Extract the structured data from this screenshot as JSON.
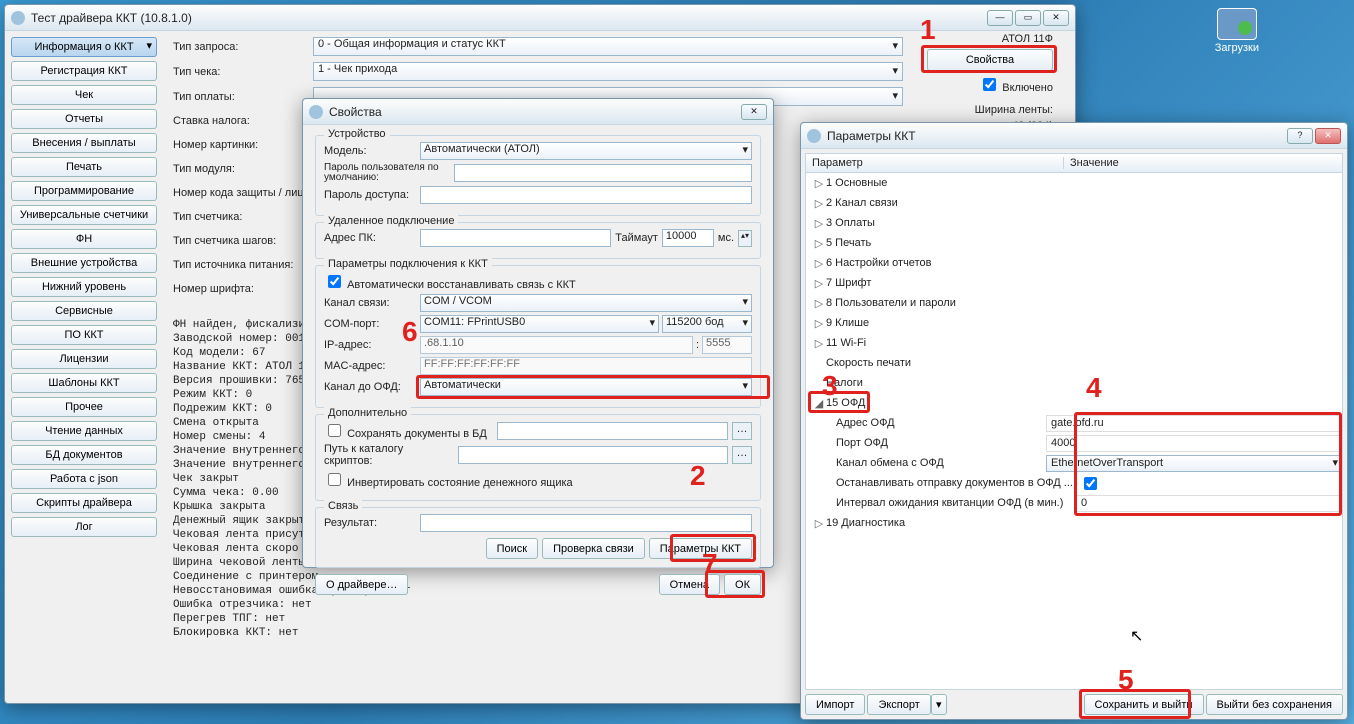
{
  "desktop": {
    "downloads": "Загрузки"
  },
  "main": {
    "title": "Тест драйвера ККТ (10.8.1.0)",
    "sidebar": [
      "Информация о ККТ",
      "Регистрация ККТ",
      "Чек",
      "Отчеты",
      "Внесения / выплаты",
      "Печать",
      "Программирование",
      "Универсальные счетчики",
      "ФН",
      "Внешние устройства",
      "Нижний уровень",
      "Сервисные",
      "ПО ККТ",
      "Лицензии",
      "Шаблоны ККТ",
      "Прочее",
      "Чтение данных",
      "БД документов",
      "Работа с json",
      "Скрипты драйвера",
      "Лог"
    ],
    "labels": {
      "reqtype": "Тип запроса:",
      "chktype": "Тип чека:",
      "paytype": "Тип оплаты:",
      "taxrate": "Ставка налога:",
      "picnum": "Номер картинки:",
      "modtype": "Тип модуля:",
      "liccode": "Номер кода защиты / лицензии:",
      "cnttype": "Тип счетчика:",
      "stepcnt": "Тип счетчика шагов:",
      "pwrsrc": "Тип источника питания:",
      "fontnum": "Номер шрифта:"
    },
    "vals": {
      "reqtype": "0 - Общая информация и статус ККТ",
      "chktype": "1 - Чек прихода"
    },
    "props_btn": "Свойства",
    "enabled": "Включено",
    "tape_lbl": "Ширина ленты:",
    "tape_val": "42 (384)",
    "device": "АТОЛ 11Ф",
    "log": "ФН найден, фискализиро\nЗаводской номер: 00106\nКод модели: 67\nНазвание ККТ: АТОЛ 11Ф\nВерсия прошивки: 7651\nРежим ККТ: 0\nПодрежим ККТ: 0\nСмена открыта\nНомер смены: 4\nЗначение внутреннего в\nЗначение внутреннего в\nЧек закрыт\nСумма чека: 0.00\nКрышка закрыта\nДенежный ящик закрыт\nЧековая лента присутст\nЧековая лента скоро за\nШирина чековой ленты:\nСоединение с принтером\nНевосстановимая ошибка принтера: нет\nОшибка отрезчика: нет\nПерегрев ТПГ: нет\nБлокировка ККТ: нет"
  },
  "props": {
    "title": "Свойства",
    "grp_device": "Устройство",
    "model_lbl": "Модель:",
    "model": "Автоматически (АТОЛ)",
    "pwd1_lbl": "Пароль пользователя по умолчанию:",
    "pwd2_lbl": "Пароль доступа:",
    "grp_remote": "Удаленное подключение",
    "pcaddr_lbl": "Адрес ПК:",
    "timeout_lbl": "Таймаут",
    "timeout": "10000",
    "timeout_unit": "мс.",
    "grp_params": "Параметры подключения к ККТ",
    "auto_restore": "Автоматически восстанавливать связь с ККТ",
    "channel_lbl": "Канал связи:",
    "channel": "COM / VCOM",
    "comport_lbl": "COM-порт:",
    "comport": "COM11: FPrintUSB0",
    "baud": "115200 бод",
    "ip_lbl": "IP-адрес:",
    "ip": ".68.1.10",
    "port": "5555",
    "mac_lbl": "MAC-адрес:",
    "mac": "FF:FF:FF:FF:FF:FF",
    "ofdch_lbl": "Канал до ОФД:",
    "ofdch": "Автоматически",
    "grp_extra": "Дополнительно",
    "savedb": "Сохранять документы в БД",
    "scriptpath_lbl": "Путь к каталогу скриптов:",
    "invert": "Инвертировать состояние денежного ящика",
    "grp_conn": "Связь",
    "result_lbl": "Результат:",
    "btn_search": "Поиск",
    "btn_check": "Проверка связи",
    "btn_params": "Параметры ККТ",
    "btn_about": "О драйвере…",
    "btn_cancel": "Отмена",
    "btn_ok": "ОК"
  },
  "params": {
    "title": "Параметры ККТ",
    "col1": "Параметр",
    "col2": "Значение",
    "nodes": [
      "1 Основные",
      "2 Канал связи",
      "3 Оплаты",
      "5 Печать",
      "6 Настройки отчетов",
      "7 Шрифт",
      "8 Пользователи и пароли",
      "9 Клише",
      "11 Wi-Fi",
      "Скорость печати",
      "Налоги",
      "15 ОФД"
    ],
    "ofd": {
      "addr_lbl": "Адрес ОФД",
      "addr": "gate.ofd.ru",
      "port_lbl": "Порт ОФД",
      "port": "4000",
      "ch_lbl": "Канал обмена с ОФД",
      "ch": "EthernetOverTransport",
      "stop_lbl": "Останавливать отправку документов в ОФД ...",
      "intv_lbl": "Интервал ожидания квитанции ОФД (в мин.)",
      "intv": "0"
    },
    "diag": "19 Диагностика",
    "btn_import": "Импорт",
    "btn_export": "Экспорт",
    "btn_save": "Сохранить и выйти",
    "btn_exit": "Выйти без сохранения"
  },
  "marks": {
    "n1": "1",
    "n2": "2",
    "n3": "3",
    "n4": "4",
    "n5": "5",
    "n6": "6",
    "n7": "7"
  }
}
